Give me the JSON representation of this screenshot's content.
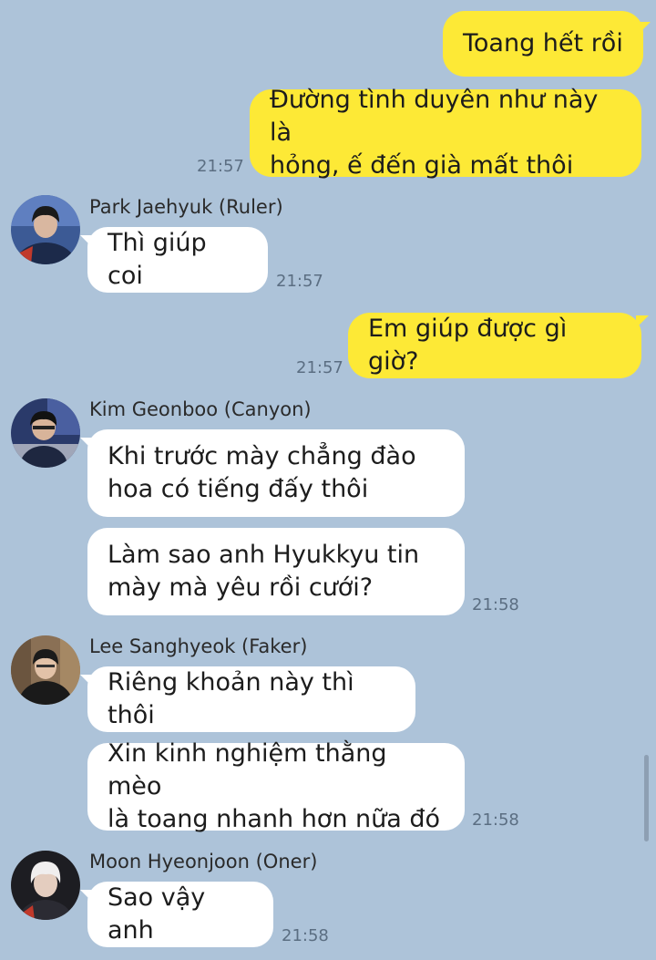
{
  "messages": [
    {
      "type": "me",
      "text": "Toang hết rồi"
    },
    {
      "type": "me",
      "text": "Đường tình duyên như này là\nhỏng, ế đến già mất thôi",
      "time": "21:57"
    },
    {
      "type": "them",
      "sender": "Park Jaehyuk (Ruler)",
      "avatar": "ruler-avatar",
      "text": "Thì giúp coi",
      "time": "21:57"
    },
    {
      "type": "me",
      "text": "Em giúp được gì giờ?",
      "time": "21:57"
    },
    {
      "type": "them",
      "sender": "Kim Geonboo (Canyon)",
      "avatar": "canyon-avatar",
      "text": "Khi trước mày chẳng đào\nhoa có tiếng đấy thôi"
    },
    {
      "type": "them",
      "text": "Làm sao anh Hyukkyu tin\nmày mà yêu rồi cưới?",
      "time": "21:58"
    },
    {
      "type": "them",
      "sender": "Lee Sanghyeok (Faker)",
      "avatar": "faker-avatar",
      "text": "Riêng khoản này thì thôi"
    },
    {
      "type": "them",
      "text": "Xin kinh nghiệm thằng mèo\nlà toang nhanh hơn nữa đó",
      "time": "21:58"
    },
    {
      "type": "them",
      "sender": "Moon Hyeonjoon (Oner)",
      "avatar": "oner-avatar",
      "text": "Sao vậy anh",
      "time": "21:58"
    }
  ],
  "colors": {
    "background": "#adc3d9",
    "my_bubble": "#fde936",
    "their_bubble": "#ffffff",
    "timestamp": "#5b6e82"
  }
}
